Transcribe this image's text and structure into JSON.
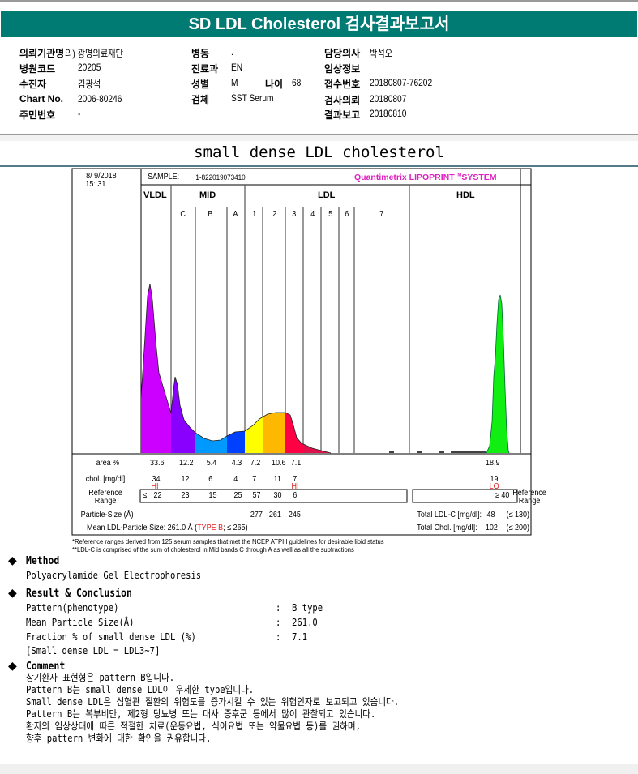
{
  "title": "SD LDL Cholesterol 검사결과보고서",
  "info": {
    "institution_label": "의뢰기관명",
    "institution": "의) 광명의료재단",
    "hospital_code_label": "병원코드",
    "hospital_code": "20205",
    "patient_label": "수진자",
    "patient": "김광석",
    "chart_no_label": "Chart No.",
    "chart_no": "2006-80246",
    "resident_no_label": "주민번호",
    "resident_no": "-",
    "ward_label": "병동",
    "ward": ".",
    "dept_label": "진료과",
    "dept": "EN",
    "sex_label": "성별",
    "sex": "M",
    "age_label": "나이",
    "age": "68",
    "specimen_label": "검체",
    "specimen": "SST Serum",
    "doctor_label": "담당의사",
    "doctor": "박석오",
    "clinical_label": "임상정보",
    "receipt_label": "접수번호",
    "receipt": "20180807-76202",
    "request_label": "검사의뢰",
    "request": "20180807",
    "report_label": "결과보고",
    "report": "20180810"
  },
  "subtitle": "small dense LDL cholesterol",
  "lipoprint": {
    "date": "8/ 9/2018",
    "time": "15: 31",
    "sample_label": "SAMPLE:",
    "sample": "1-822019073410",
    "brand": "Quantimetrix LIPOPRINT",
    "brand_tm": "TM",
    "brand_suffix": "SYSTEM",
    "groups": [
      "VLDL",
      "MID",
      "LDL",
      "HDL"
    ],
    "bands": [
      "C",
      "B",
      "A",
      "1",
      "2",
      "3",
      "4",
      "5",
      "6",
      "7"
    ],
    "colors": {
      "VLDL": "#cc00ff",
      "C": "#8a00ff",
      "B": "#0099ff",
      "A": "#0040ff",
      "1": "#ffff00",
      "2": "#ffb800",
      "3": "#ff0044",
      "tail": "#e0104a",
      "HDL": "#11ee11"
    },
    "area_label": "area %",
    "area": [
      "33.6",
      "12.2",
      "5.4",
      "4.3",
      "7.2",
      "10.6",
      "7.1"
    ],
    "area_hdl": "18.9",
    "chol_label": "chol. [mg/dl]",
    "chol": [
      "34",
      "12",
      "6",
      "4",
      "7",
      "11",
      "7"
    ],
    "chol_hdl": "19",
    "flag_vldl": "HI",
    "flag_ldl3": "HI",
    "flag_hdl": "LO",
    "ref_label_1": "Reference",
    "ref_label_2": "Range",
    "ref_prefix": "≤",
    "ref": [
      "22",
      "23",
      "15",
      "25",
      "57",
      "30",
      "6"
    ],
    "ref_hdl": "≥ 40",
    "particle_label": "Particle-Size (Å)",
    "particle": [
      "277",
      "261",
      "245"
    ],
    "mean_label": "Mean LDL-Particle Size:",
    "mean_value": "261.0 Å",
    "mean_type": "TYPE B",
    "mean_ref": "; ≤ 265",
    "total_ldl_label": "Total LDL-C [mg/dl]:",
    "total_ldl": "48",
    "total_ldl_ref": "(≤ 130)",
    "total_chol_label": "Total Chol. [mg/dl]:",
    "total_chol": "102",
    "total_chol_ref": "(≤ 200)",
    "footnote1": "*Reference ranges derived from 125 serum samples that met the NCEP ATPIII guidelines for desirable lipid status",
    "footnote2": "**LDL-C is comprised of the sum of cholesterol in Mid bands C through A as well as all the subfractions"
  },
  "method": {
    "title": "Method",
    "text": "Polyacrylamide Gel Electrophoresis"
  },
  "result": {
    "title": "Result & Conclusion",
    "rows": [
      {
        "label": "Pattern(phenotype)",
        "value": "B type"
      },
      {
        "label": "Mean Particle Size(Å)",
        "value": "261.0"
      },
      {
        "label": "Fraction % of small dense LDL (%)",
        "value": "7.1"
      }
    ],
    "note": "[Small dense LDL = LDL3~7]",
    "colon": ":"
  },
  "comment": {
    "title": "Comment",
    "lines": [
      "상기환자 표현형은 pattern B입니다.",
      "Pattern B는 small dense LDL이 우세한 type입니다.",
      "Small dense LDL은 심혈관 질환의 위험도를 증가시킬 수 있는 위험인자로 보고되고 있습니다.",
      "Pattern B는 복부비만, 제2형 당뇨병 또는 대사 증후군 등에서 많이 관찰되고 있습니다.",
      "환자의 임상상태에 따른 적절한 치료(운동요법, 식이요법 또는 약물요법 등)를 권하며,",
      "향후 pattern 변화에 대한 확인을 권유합니다."
    ]
  }
}
